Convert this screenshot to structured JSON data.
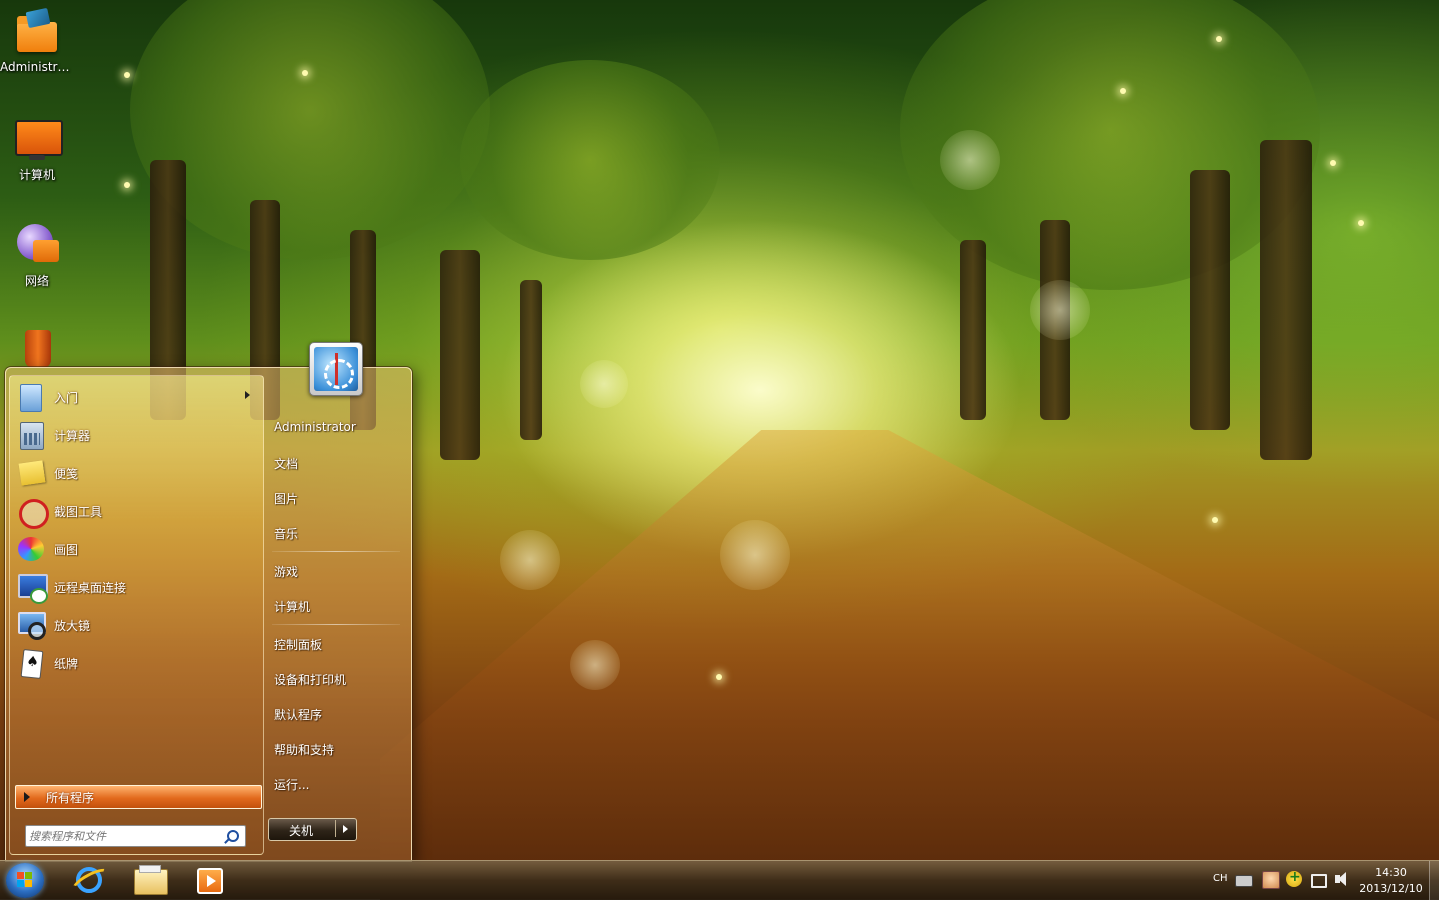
{
  "desktop": {
    "icons": [
      {
        "label": "Administra...",
        "icon": "user-folder-icon"
      },
      {
        "label": "计算机",
        "icon": "computer-icon"
      },
      {
        "label": "网络",
        "icon": "network-icon"
      },
      {
        "label": "",
        "icon": "recycle-bin-icon"
      }
    ]
  },
  "start_menu": {
    "programs": [
      {
        "label": "入门",
        "icon": "getting-started-icon",
        "has_submenu": true
      },
      {
        "label": "计算器",
        "icon": "calculator-icon"
      },
      {
        "label": "便笺",
        "icon": "sticky-notes-icon"
      },
      {
        "label": "截图工具",
        "icon": "snipping-tool-icon"
      },
      {
        "label": "画图",
        "icon": "paint-icon"
      },
      {
        "label": "远程桌面连接",
        "icon": "remote-desktop-icon"
      },
      {
        "label": "放大镜",
        "icon": "magnifier-icon"
      },
      {
        "label": "纸牌",
        "icon": "solitaire-icon"
      }
    ],
    "all_programs": "所有程序",
    "search": {
      "placeholder": "搜索程序和文件",
      "value": ""
    },
    "right_links": [
      {
        "label": "Administrator"
      },
      {
        "label": "文档"
      },
      {
        "label": "图片"
      },
      {
        "label": "音乐"
      },
      {
        "label": "游戏"
      },
      {
        "label": "计算机"
      },
      {
        "label": "控制面板"
      },
      {
        "label": "设备和打印机"
      },
      {
        "label": "默认程序"
      },
      {
        "label": "帮助和支持"
      },
      {
        "label": "运行..."
      }
    ],
    "shutdown_label": "关机"
  },
  "taskbar": {
    "pinned": [
      {
        "name": "internet-explorer",
        "icon": "internet-explorer-icon"
      },
      {
        "name": "windows-explorer",
        "icon": "windows-explorer-icon"
      },
      {
        "name": "media-player",
        "icon": "media-player-icon"
      }
    ],
    "tray": {
      "language": "CH",
      "time": "14:30",
      "date": "2013/12/10"
    }
  },
  "colors": {
    "accent": "#e26a1d",
    "taskbar": "#3c2d18",
    "orb": "#2b6ec2"
  }
}
